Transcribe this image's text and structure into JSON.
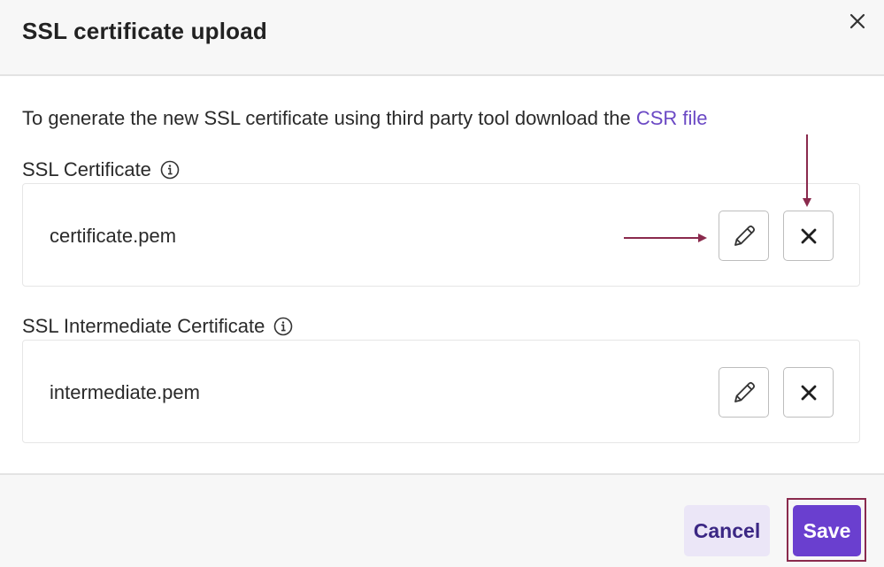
{
  "dialog": {
    "title": "SSL certificate upload",
    "close_icon": "close-icon"
  },
  "intro": {
    "text": "To generate the new SSL certificate using third party tool download the ",
    "link_text": "CSR file",
    "link_color": "#6a48c4"
  },
  "sections": [
    {
      "label": "SSL Certificate",
      "info_icon": "info-icon",
      "file_name": "certificate.pem",
      "edit_icon": "pencil-icon",
      "remove_icon": "close-icon"
    },
    {
      "label": "SSL Intermediate Certificate",
      "info_icon": "info-icon",
      "file_name": "intermediate.pem",
      "edit_icon": "pencil-icon",
      "remove_icon": "close-icon"
    }
  ],
  "footer": {
    "cancel_label": "Cancel",
    "save_label": "Save"
  },
  "colors": {
    "accent": "#6a3fcf",
    "cancel_bg": "#ebe6f7",
    "annotation": "#8a2a4d"
  }
}
